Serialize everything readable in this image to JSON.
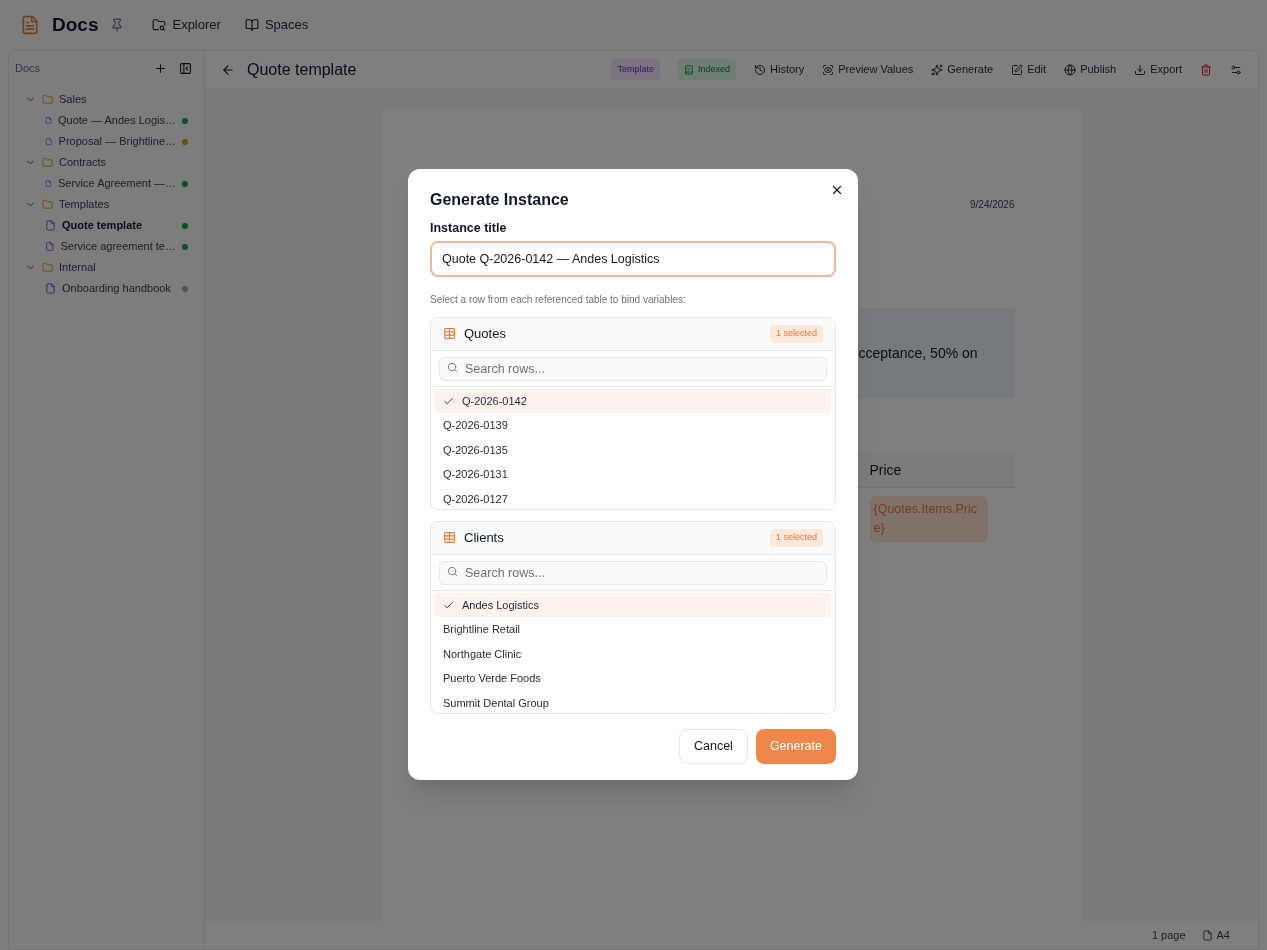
{
  "app": {
    "name": "Docs"
  },
  "nav": [
    {
      "label": "Explorer",
      "kind": "explorer"
    },
    {
      "label": "Spaces",
      "kind": "spaces"
    }
  ],
  "sidebar": {
    "title": "Docs",
    "tree": [
      {
        "label": "Sales",
        "expanded": true,
        "children": [
          {
            "label": "Quote — Andes Logis…",
            "kind": "doc",
            "color": "#0b5124",
            "selected": false
          },
          {
            "label": "Proposal — Brightline…",
            "kind": "doc",
            "color": "#6c4d05",
            "selected": false
          }
        ]
      },
      {
        "label": "Contracts",
        "expanded": true,
        "children": [
          {
            "label": "Service Agreement —…",
            "kind": "doc",
            "color": "#0b5124",
            "selected": false
          }
        ]
      },
      {
        "label": "Templates",
        "expanded": true,
        "children": [
          {
            "label": "Quote template",
            "kind": "template",
            "color": "#0b5124",
            "selected": true
          },
          {
            "label": "Service agreement te…",
            "kind": "template",
            "color": "#0b5124",
            "selected": false
          }
        ]
      },
      {
        "label": "Internal",
        "expanded": true,
        "children": [
          {
            "label": "Onboarding handbook",
            "kind": "doc",
            "color": "#525252",
            "selected": false
          }
        ]
      }
    ]
  },
  "header": {
    "title": "Quote template",
    "badges": [
      {
        "label": "Template",
        "kind": "tag"
      },
      {
        "label": "Indexed",
        "kind": "indexed"
      }
    ],
    "actions": [
      {
        "label": "History",
        "kind": "history"
      },
      {
        "label": "Preview Values",
        "kind": "preview"
      },
      {
        "label": "Generate",
        "kind": "generate"
      },
      {
        "label": "Edit",
        "kind": "edit"
      },
      {
        "label": "Publish",
        "kind": "publish"
      },
      {
        "label": "Export",
        "kind": "export"
      },
      {
        "kind": "delete"
      },
      {
        "kind": "settings"
      }
    ]
  },
  "document": {
    "date": "9/24/2026",
    "callout": "cceptance, 50% on",
    "table": {
      "column": "Price",
      "cell": "{Quotes.Items.Price}"
    }
  },
  "status_bar": {
    "pages": "1 page",
    "size": "A4"
  },
  "modal": {
    "title": "Generate Instance",
    "field_label": "Instance title",
    "field_value": "Quote Q-2026-0142 — Andes Logistics",
    "hint": "Select a row from each referenced table to bind variables:",
    "sections": [
      {
        "name": "Quotes",
        "badge": "1 selected",
        "placeholder": "Search rows...",
        "rows": [
          {
            "label": "Q-2026-0142",
            "selected": true
          },
          {
            "label": "Q-2026-0139",
            "selected": false
          },
          {
            "label": "Q-2026-0135",
            "selected": false
          },
          {
            "label": "Q-2026-0131",
            "selected": false
          },
          {
            "label": "Q-2026-0127",
            "selected": false
          }
        ]
      },
      {
        "name": "Clients",
        "badge": "1 selected",
        "placeholder": "Search rows...",
        "rows": [
          {
            "label": "Andes Logistics",
            "selected": true
          },
          {
            "label": "Brightline Retail",
            "selected": false
          },
          {
            "label": "Northgate Clinic",
            "selected": false
          },
          {
            "label": "Puerto Verde Foods",
            "selected": false
          },
          {
            "label": "Summit Dental Group",
            "selected": false
          }
        ]
      }
    ],
    "buttons": [
      {
        "label": "Cancel",
        "kind": "secondary"
      },
      {
        "label": "Generate",
        "kind": "primary"
      }
    ]
  }
}
